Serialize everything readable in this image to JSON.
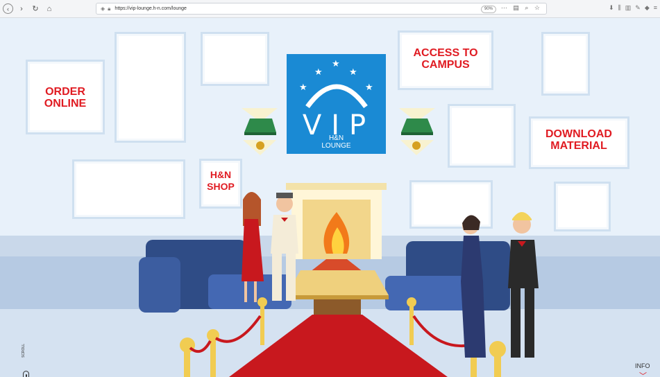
{
  "browser": {
    "url": "https://vip-lounge.h-n.com/lounge",
    "zoom": "90%",
    "back_icon": "back-arrow-icon",
    "forward_icon": "forward-arrow-icon"
  },
  "scene": {
    "vip_sign": {
      "title": "VIP",
      "subtitle_line1": "H&N",
      "subtitle_line2": "LOUNGE"
    },
    "links": {
      "order_online": {
        "line1": "ORDER",
        "line2": "ONLINE"
      },
      "access_campus": {
        "line1": "ACCESS TO",
        "line2": "CAMPUS"
      },
      "download_material": {
        "line1": "DOWNLOAD",
        "line2": "MATERIAL"
      },
      "shop": {
        "line1": "H&N",
        "line2": "SHOP"
      }
    },
    "scroll_hint": "SCROLL",
    "info": "INFO"
  },
  "colors": {
    "accent": "#e01b22",
    "vip_blue": "#1a8ad4",
    "sofa": "#2f4c86",
    "carpet": "#c8181e"
  }
}
